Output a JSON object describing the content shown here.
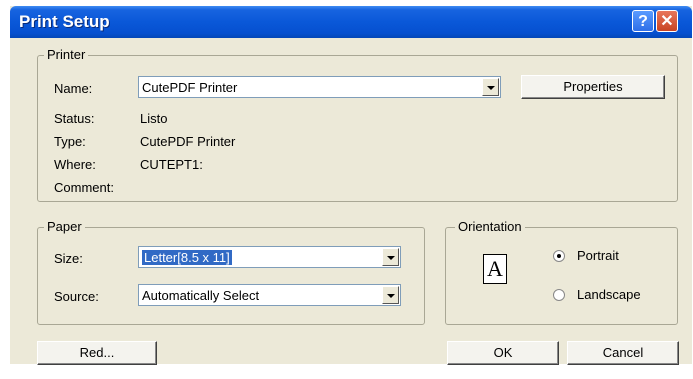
{
  "window": {
    "title": "Print Setup"
  },
  "titlebar": {
    "help_label": "?",
    "close_label": "✕"
  },
  "printer": {
    "legend": "Printer",
    "name_label": "Name:",
    "name_value": "CutePDF Printer",
    "properties_label": "Properties",
    "status_label": "Status:",
    "status_value": "Listo",
    "type_label": "Type:",
    "type_value": "CutePDF Printer",
    "where_label": "Where:",
    "where_value": "CUTEPT1:",
    "comment_label": "Comment:"
  },
  "paper": {
    "legend": "Paper",
    "size_label": "Size:",
    "size_value": "Letter[8.5 x 11]",
    "source_label": "Source:",
    "source_value": "Automatically Select"
  },
  "orientation": {
    "legend": "Orientation",
    "page_glyph": "A",
    "portrait_label": "Portrait",
    "landscape_label": "Landscape",
    "selected": "Portrait"
  },
  "buttons": {
    "red_label": "Red...",
    "ok_label": "OK",
    "cancel_label": "Cancel"
  }
}
